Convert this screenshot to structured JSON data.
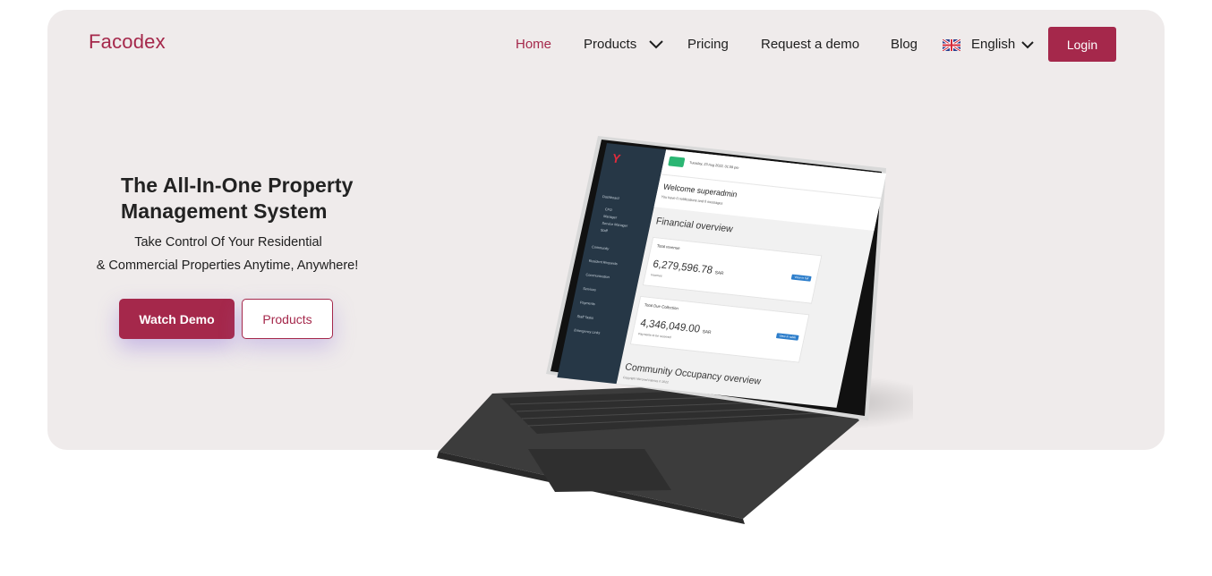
{
  "brand": {
    "name": "Facodex",
    "color": "#a5284b"
  },
  "nav": {
    "home": "Home",
    "products": "Products",
    "pricing": "Pricing",
    "request_demo": "Request a demo",
    "blog": "Blog",
    "language": "English",
    "login": "Login"
  },
  "hero": {
    "headline": "The All-In-One Property Management System",
    "sub_line1": "Take Control Of Your Residential",
    "sub_line2": "& Commercial Properties Anytime, Anywhere!",
    "watch_demo": "Watch Demo",
    "products": "Products"
  },
  "tablet_screen": {
    "date": "Tuesday, 23 Aug 2022, 01:09 pm",
    "welcome": "Welcome superadmin",
    "welcome_sub": "You have 0 notifications and 0 messages",
    "financial_title": "Financial overview",
    "card1": {
      "label": "Total revenue",
      "value": "6,279,596.78",
      "unit": "SAR",
      "tag": "View in full",
      "sub": "Incomes"
    },
    "card2": {
      "label": "Total Due Collection",
      "value": "4,346,049.00",
      "unit": "SAR",
      "tag": "View in table",
      "sub": "Payments to be received"
    },
    "occupancy_title": "Community Occupancy overview",
    "copyright": "Copyright Mirrored Fabrics © 2022",
    "sidebar": [
      "Dashboard",
      "CFO",
      "Manager",
      "Service Manager",
      "Staff",
      "Community",
      "Resident Requests",
      "Communication",
      "Services",
      "Payments",
      "Staff Tasks",
      "Emergency Links"
    ]
  },
  "colors": {
    "accent": "#a5284b",
    "hero_bg": "#efebeb",
    "screen_sidebar": "#263746",
    "screen_green": "#2bb673"
  }
}
